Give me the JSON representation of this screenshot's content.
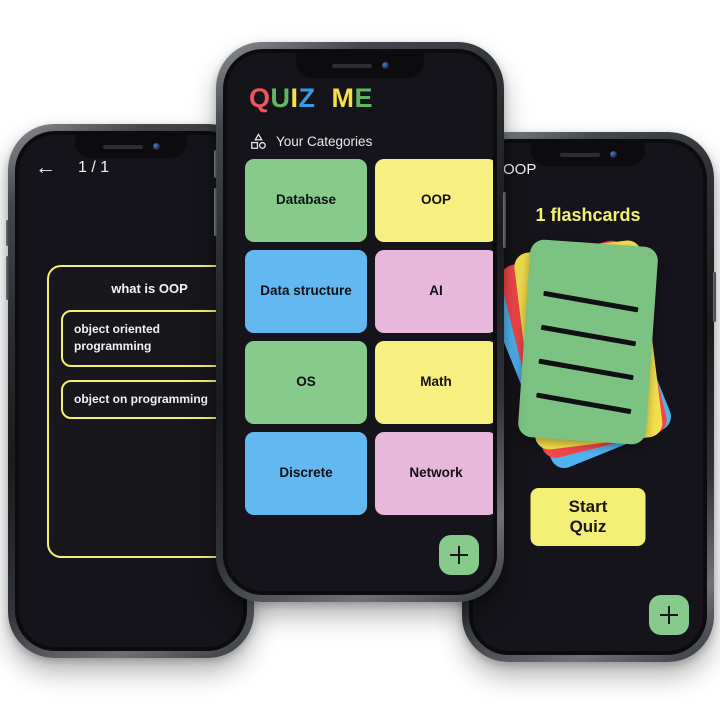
{
  "app": {
    "background_color": "#ffffff",
    "screen_bg": "#14141a"
  },
  "center_phone": {
    "logo": {
      "letters": [
        {
          "char": "Q",
          "color": "#f2545b"
        },
        {
          "char": "U",
          "color": "#5fb860"
        },
        {
          "char": "I",
          "color": "#f4e04d"
        },
        {
          "char": "Z",
          "color": "#3b9ae1"
        },
        {
          "char": " ",
          "color": "#ffffff"
        },
        {
          "char": "M",
          "color": "#f4e04d"
        },
        {
          "char": "E",
          "color": "#5fb860"
        }
      ],
      "full_text": "QUIZ ME"
    },
    "section": {
      "icon": "shapes-icon",
      "title": "Your Categories"
    },
    "categories": [
      {
        "label": "Database",
        "color": "#86cb8b"
      },
      {
        "label": "OOP",
        "color": "#f7ef7f"
      },
      {
        "label": "Data structure",
        "color": "#63b8f2"
      },
      {
        "label": "AI",
        "color": "#e8b8dc"
      },
      {
        "label": "OS",
        "color": "#86cb8b"
      },
      {
        "label": "Math",
        "color": "#f7ef7f"
      },
      {
        "label": "Discrete",
        "color": "#63b8f2"
      },
      {
        "label": "Network",
        "color": "#e8b8dc"
      }
    ],
    "add_button": {
      "icon": "plus-icon",
      "color": "#86cb8b"
    }
  },
  "left_phone": {
    "back_icon": "←",
    "counter": "1 / 1",
    "question": "what is OOP",
    "answers": [
      {
        "text": "object oriented programming"
      },
      {
        "text": "object on programming"
      }
    ],
    "accent_color": "#f4ef75"
  },
  "right_phone": {
    "title": "OOP",
    "flashcard_count_label": "1 flashcards",
    "count_color": "#f4ef75",
    "deck": [
      {
        "color": "#4fb3f0",
        "rotation": -22
      },
      {
        "color": "#f2474a",
        "rotation": -14
      },
      {
        "color": "#f4e04d",
        "rotation": -7
      },
      {
        "color": "#7cc383",
        "rotation": 4
      }
    ],
    "start_button": "Start Quiz",
    "start_button_color": "#f4ef75",
    "add_button": {
      "icon": "plus-icon",
      "color": "#86cb8b"
    }
  }
}
